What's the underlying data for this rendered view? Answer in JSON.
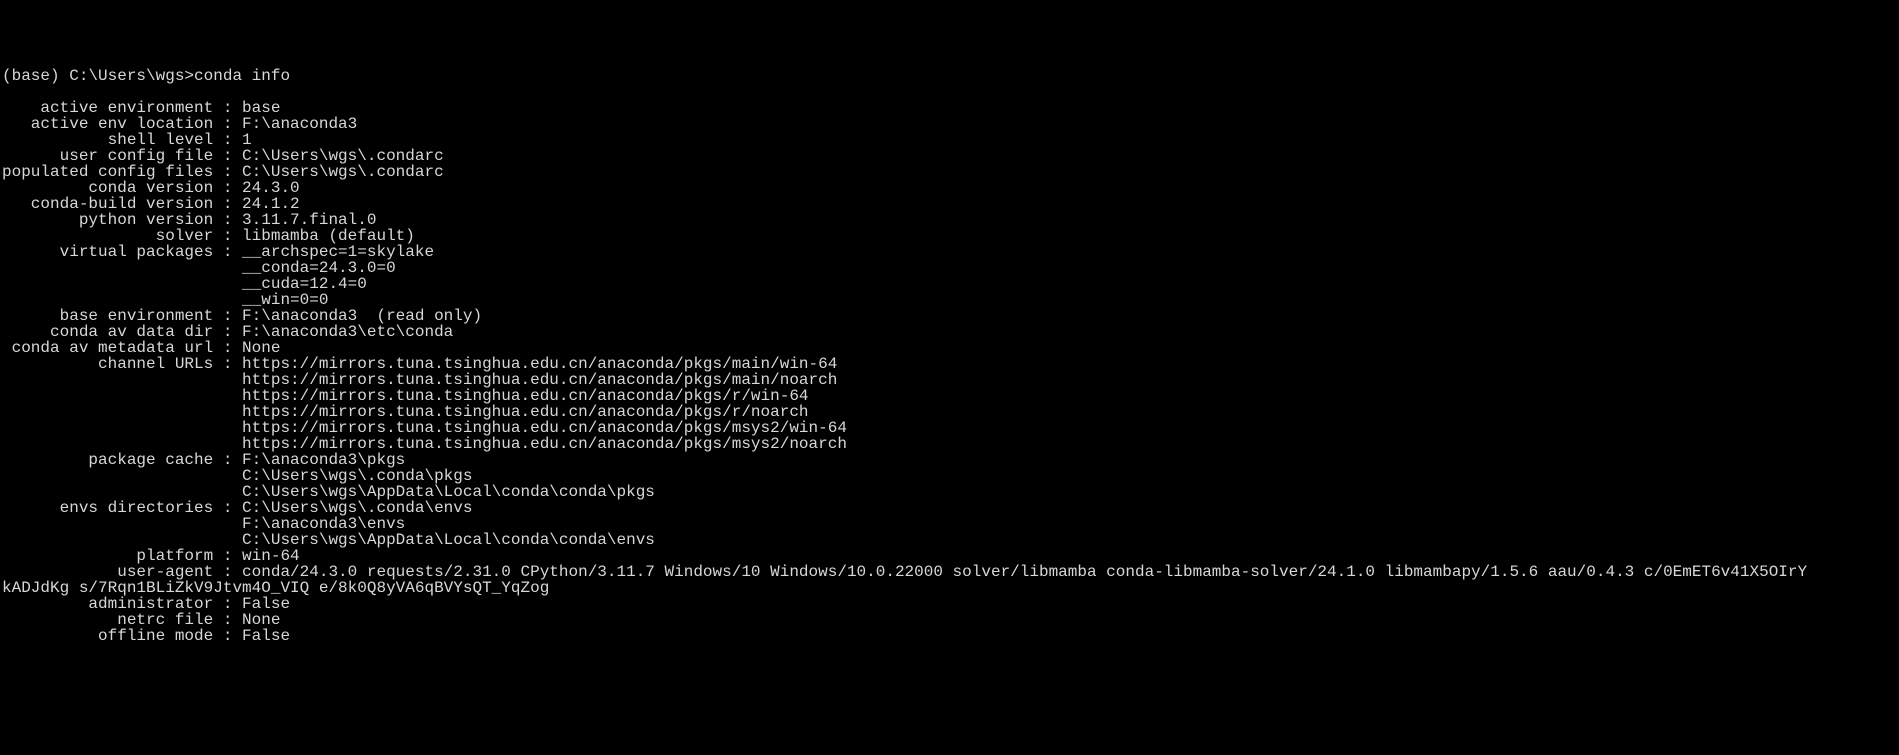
{
  "prompt": "(base) C:\\Users\\wgs>conda info",
  "blank": "",
  "fields": [
    {
      "label": "    active environment",
      "value": "base"
    },
    {
      "label": "   active env location",
      "value": "F:\\anaconda3"
    },
    {
      "label": "           shell level",
      "value": "1"
    },
    {
      "label": "      user config file",
      "value": "C:\\Users\\wgs\\.condarc"
    },
    {
      "label": "populated config files",
      "value": "C:\\Users\\wgs\\.condarc"
    },
    {
      "label": "         conda version",
      "value": "24.3.0"
    },
    {
      "label": "   conda-build version",
      "value": "24.1.2"
    },
    {
      "label": "        python version",
      "value": "3.11.7.final.0"
    },
    {
      "label": "                solver",
      "value": "libmamba (default)"
    },
    {
      "label": "      virtual packages",
      "value": "__archspec=1=skylake"
    },
    {
      "label": null,
      "value": "__conda=24.3.0=0"
    },
    {
      "label": null,
      "value": "__cuda=12.4=0"
    },
    {
      "label": null,
      "value": "__win=0=0"
    },
    {
      "label": "      base environment",
      "value": "F:\\anaconda3  (read only)"
    },
    {
      "label": "     conda av data dir",
      "value": "F:\\anaconda3\\etc\\conda"
    },
    {
      "label": " conda av metadata url",
      "value": "None"
    },
    {
      "label": "          channel URLs",
      "value": "https://mirrors.tuna.tsinghua.edu.cn/anaconda/pkgs/main/win-64"
    },
    {
      "label": null,
      "value": "https://mirrors.tuna.tsinghua.edu.cn/anaconda/pkgs/main/noarch"
    },
    {
      "label": null,
      "value": "https://mirrors.tuna.tsinghua.edu.cn/anaconda/pkgs/r/win-64"
    },
    {
      "label": null,
      "value": "https://mirrors.tuna.tsinghua.edu.cn/anaconda/pkgs/r/noarch"
    },
    {
      "label": null,
      "value": "https://mirrors.tuna.tsinghua.edu.cn/anaconda/pkgs/msys2/win-64"
    },
    {
      "label": null,
      "value": "https://mirrors.tuna.tsinghua.edu.cn/anaconda/pkgs/msys2/noarch"
    },
    {
      "label": "         package cache",
      "value": "F:\\anaconda3\\pkgs"
    },
    {
      "label": null,
      "value": "C:\\Users\\wgs\\.conda\\pkgs"
    },
    {
      "label": null,
      "value": "C:\\Users\\wgs\\AppData\\Local\\conda\\conda\\pkgs"
    },
    {
      "label": "      envs directories",
      "value": "C:\\Users\\wgs\\.conda\\envs"
    },
    {
      "label": null,
      "value": "F:\\anaconda3\\envs"
    },
    {
      "label": null,
      "value": "C:\\Users\\wgs\\AppData\\Local\\conda\\conda\\envs"
    },
    {
      "label": "              platform",
      "value": "win-64"
    }
  ],
  "user_agent_line": "            user-agent : conda/24.3.0 requests/2.31.0 CPython/3.11.7 Windows/10 Windows/10.0.22000 solver/libmamba conda-libmamba-solver/24.1.0 libmambapy/1.5.6 aau/0.4.3 c/0EmET6v41X5OIrY\nkADJdKg s/7Rqn1BLiZkV9Jtvm4O_VIQ e/8k0Q8yVA6qBVYsQT_YqZog",
  "fields_tail": [
    {
      "label": "         administrator",
      "value": "False"
    },
    {
      "label": "            netrc file",
      "value": "None"
    },
    {
      "label": "          offline mode",
      "value": "False"
    }
  ]
}
